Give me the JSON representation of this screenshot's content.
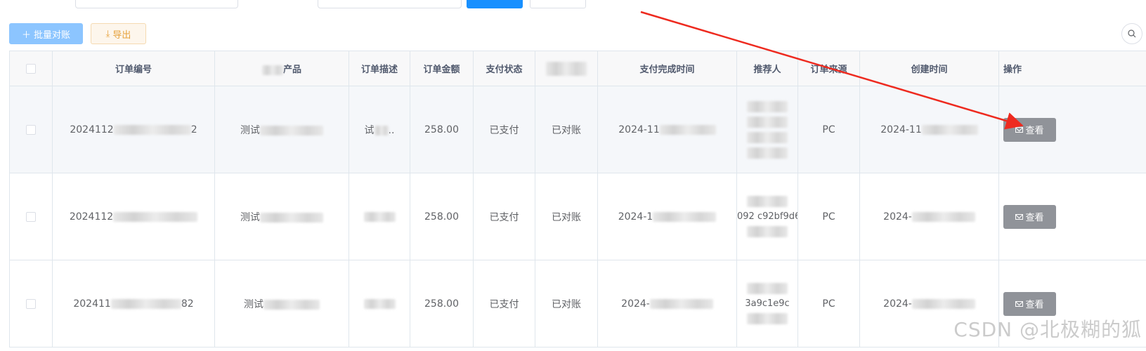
{
  "toolbar": {
    "batch_label": "批量对账",
    "export_label": "导出",
    "colors": {
      "primary_light": "#8cc5ff",
      "warning": "#e6a23c"
    }
  },
  "table": {
    "columns": [
      "订单编号",
      "产品",
      "订单描述",
      "订单金额",
      "支付状态",
      "支付完成时间",
      "推荐人",
      "订单来源",
      "创建时间",
      "操作"
    ],
    "rows": [
      {
        "order_no_prefix": "2024112",
        "order_no_suffix": "2",
        "product": "测试",
        "desc": "试",
        "desc_suffix": "..",
        "amount": "258.00",
        "pay_status": "已支付",
        "reconcile_status": "已对账",
        "paid_time": "2024-11",
        "referrer": "",
        "source": "PC",
        "created": "2024-11",
        "action": "查看"
      },
      {
        "order_no_prefix": "2024112",
        "order_no_suffix": "",
        "product": "测试",
        "desc": "",
        "desc_suffix": "",
        "amount": "258.00",
        "pay_status": "已支付",
        "reconcile_status": "已对账",
        "paid_time": "2024-1",
        "referrer": "092 c92bf9d6",
        "source": "PC",
        "created": "2024-",
        "action": "查看"
      },
      {
        "order_no_prefix": "202411",
        "order_no_suffix": "82",
        "product": "测试",
        "desc": "",
        "desc_suffix": "",
        "amount": "258.00",
        "pay_status": "已支付",
        "reconcile_status": "已对账",
        "paid_time": "2024-",
        "referrer": "3a9c1e9c",
        "source": "PC",
        "created": "2024-",
        "action": "查看"
      }
    ],
    "status_color": "#1aa87a"
  },
  "watermark": "CSDN @北极糊的狐"
}
